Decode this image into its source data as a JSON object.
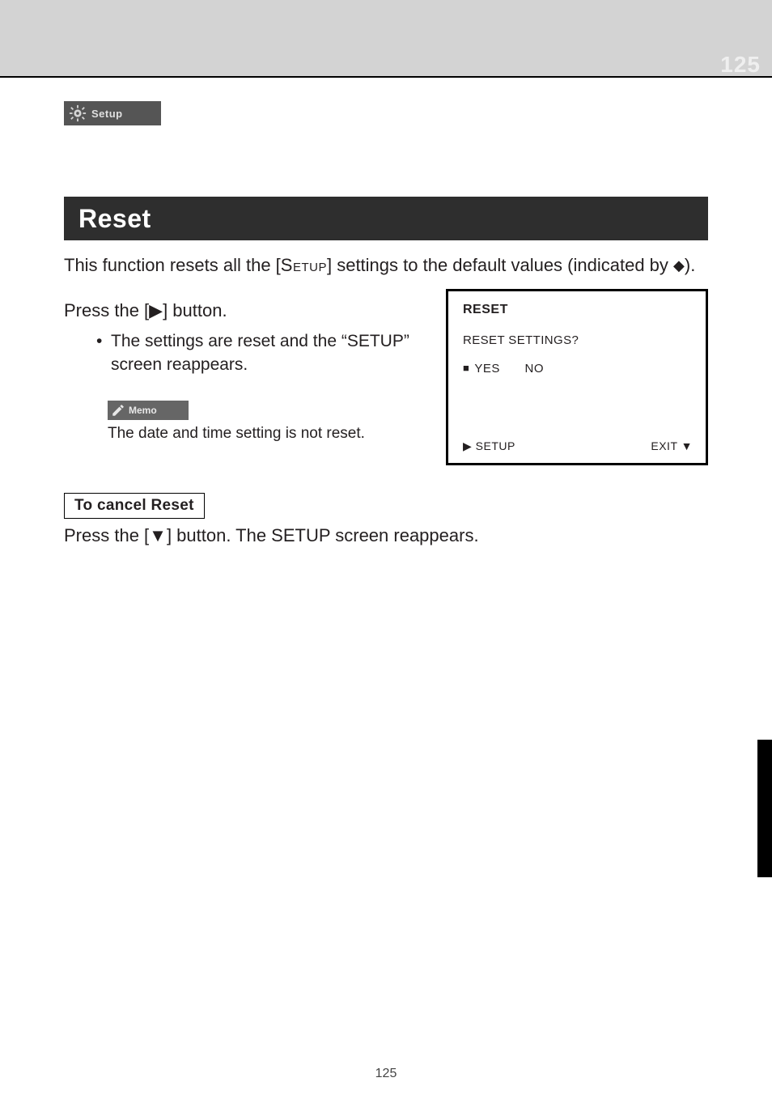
{
  "header": {
    "top_page_ghost": "125",
    "setup_label": "Setup"
  },
  "section": {
    "title": "Reset",
    "intro_prefix": "This function resets all the [",
    "intro_setup_word": "Setup",
    "intro_suffix": "] settings to the default values (indicated by ",
    "intro_diamond": "◆",
    "intro_end": ").",
    "step_text": "Press the [▶] button.",
    "bullets": [
      "The settings are reset and the “SETUP” screen reappears."
    ],
    "memo_label": "Memo",
    "memo_text": "The date and time setting is not reset."
  },
  "screen": {
    "title": "RESET",
    "prompt": "RESET SETTINGS?",
    "opt_yes": "YES",
    "opt_no": "NO",
    "hint_left_label": "SETUP",
    "hint_left_arrow": "▶",
    "hint_right_label": "EXIT",
    "hint_right_arrow": "▼"
  },
  "cancel": {
    "box_label": "To cancel Reset",
    "text_prefix": "Press the [",
    "down_arrow": "▼",
    "text_suffix": "] button. The SETUP screen reappears."
  },
  "footer": {
    "page_num": "125"
  }
}
